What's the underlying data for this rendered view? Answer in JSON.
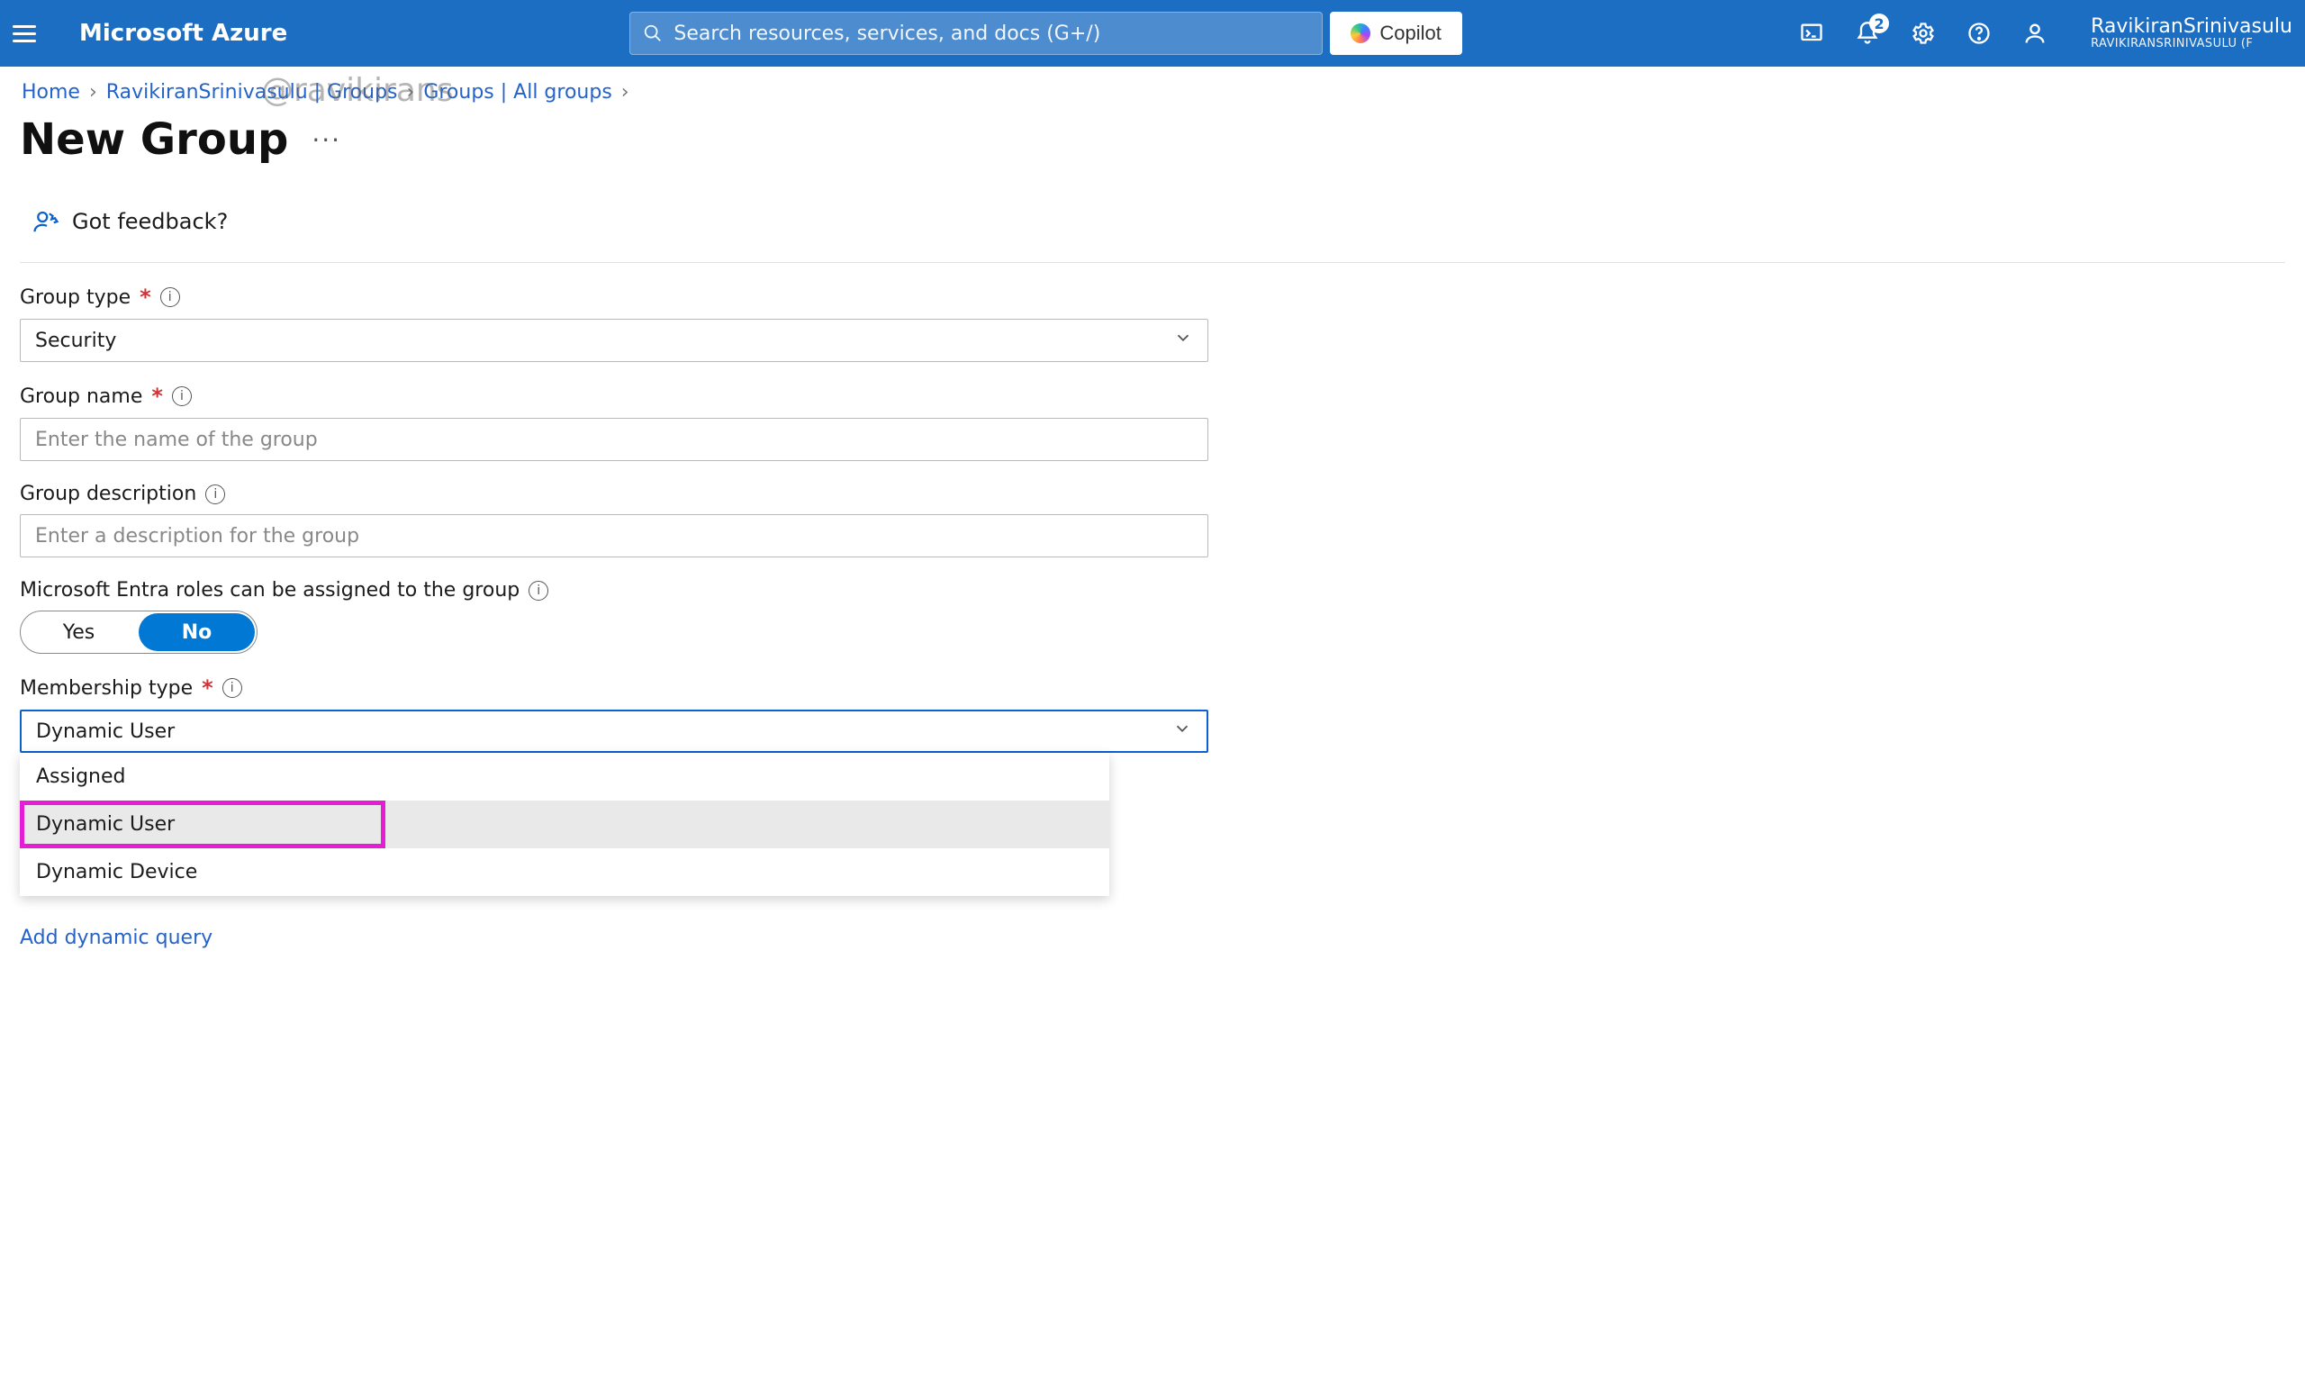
{
  "topbar": {
    "brand": "Microsoft Azure",
    "search_placeholder": "Search resources, services, and docs (G+/)",
    "copilot_label": "Copilot",
    "notification_count": "2",
    "account_name": "RavikiranSrinivasulu",
    "account_tenant": "RAVIKIRANSRINIVASULU (F"
  },
  "watermark": "@ravikirans",
  "breadcrumbs": {
    "items": [
      {
        "label": "Home"
      },
      {
        "label": "RavikiranSrinivasulu | Groups"
      },
      {
        "label": "Groups | All groups"
      }
    ]
  },
  "page": {
    "title": "New Group",
    "more": "···"
  },
  "command_bar": {
    "feedback_label": "Got feedback?"
  },
  "form": {
    "group_type": {
      "label": "Group type",
      "required": true,
      "value": "Security"
    },
    "group_name": {
      "label": "Group name",
      "required": true,
      "placeholder": "Enter the name of the group"
    },
    "group_description": {
      "label": "Group description",
      "required": false,
      "placeholder": "Enter a description for the group"
    },
    "entra_roles": {
      "label": "Microsoft Entra roles can be assigned to the group",
      "yes": "Yes",
      "no": "No",
      "value": "No"
    },
    "membership_type": {
      "label": "Membership type",
      "required": true,
      "value": "Dynamic User",
      "options": [
        "Assigned",
        "Dynamic User",
        "Dynamic Device"
      ]
    },
    "add_dynamic_query": "Add dynamic query"
  }
}
